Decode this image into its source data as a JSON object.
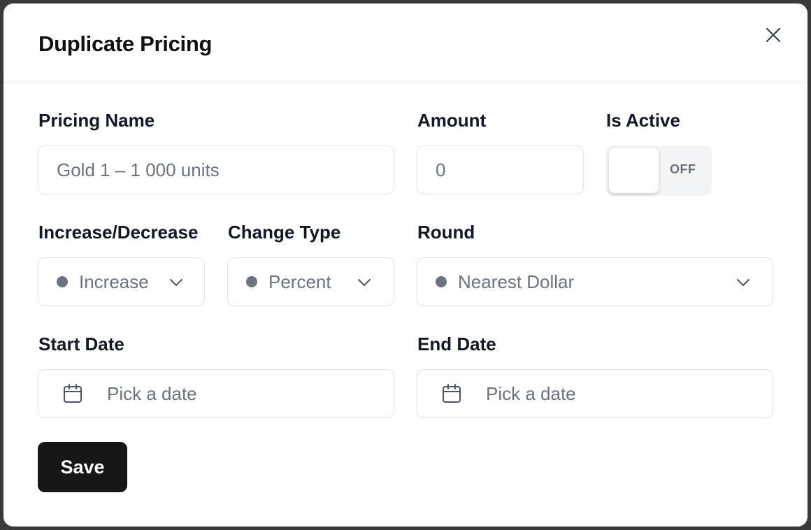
{
  "dialog": {
    "title": "Duplicate Pricing"
  },
  "form": {
    "pricing_name": {
      "label": "Pricing Name",
      "placeholder": "Gold 1 – 1 000 units"
    },
    "amount": {
      "label": "Amount",
      "value": "0"
    },
    "is_active": {
      "label": "Is Active",
      "state_text": "OFF",
      "on": false
    },
    "increase_decrease": {
      "label": "Increase/Decrease",
      "value": "Increase"
    },
    "change_type": {
      "label": "Change Type",
      "value": "Percent"
    },
    "round": {
      "label": "Round",
      "value": "Nearest Dollar"
    },
    "start_date": {
      "label": "Start Date",
      "placeholder": "Pick a date"
    },
    "end_date": {
      "label": "End Date",
      "placeholder": "Pick a date"
    }
  },
  "actions": {
    "save_label": "Save"
  },
  "icons": {
    "close": "close-icon",
    "chevron": "chevron-down-icon",
    "calendar": "calendar-icon"
  },
  "colors": {
    "primary_button": "#171717",
    "muted_text": "#6b7280",
    "border": "#e2e4e8"
  }
}
